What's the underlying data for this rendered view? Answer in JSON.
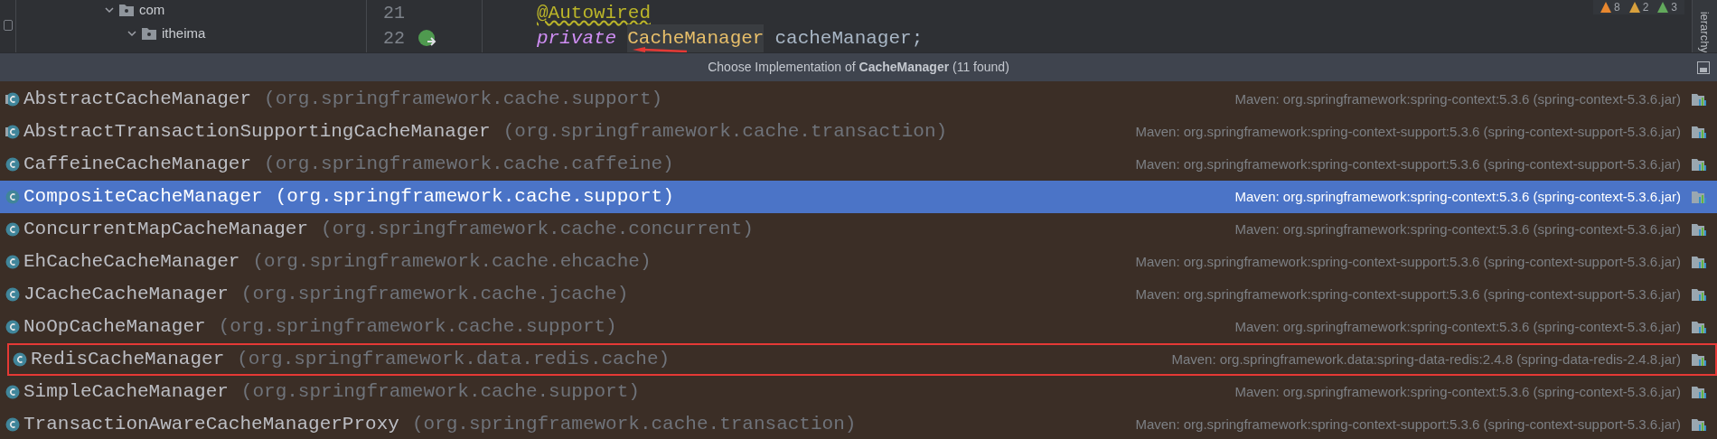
{
  "project_tree": {
    "items": [
      {
        "label": "com",
        "expanded": true
      },
      {
        "label": "itheima",
        "expanded": true
      }
    ]
  },
  "editor": {
    "lines": [
      {
        "number": "21",
        "tokens": [
          {
            "kind": "annotation",
            "text": "@Autowired"
          }
        ]
      },
      {
        "number": "22",
        "gutter_icon": true,
        "tokens": [
          {
            "kind": "keyword",
            "text": "private"
          },
          {
            "kind": "type",
            "text": "CacheManager"
          },
          {
            "kind": "plain",
            "text": "cacheManager;"
          }
        ]
      }
    ],
    "inspections": [
      {
        "kind": "error",
        "count": "8"
      },
      {
        "kind": "warning",
        "count": "2"
      },
      {
        "kind": "typo",
        "count": "3"
      }
    ],
    "side_tab": "ierarchy"
  },
  "popup": {
    "title": "Choose Implementation of **CacheManager** (11 found)",
    "rows": [
      {
        "kind": "abstract",
        "name": "AbstractCacheManager",
        "package": "(org.springframework.cache.support)",
        "location": "Maven: org.springframework:spring-context:5.3.6 (spring-context-5.3.6.jar)",
        "selected": false,
        "highlighted": false
      },
      {
        "kind": "abstract",
        "name": "AbstractTransactionSupportingCacheManager",
        "package": "(org.springframework.cache.transaction)",
        "location": "Maven: org.springframework:spring-context-support:5.3.6 (spring-context-support-5.3.6.jar)",
        "selected": false,
        "highlighted": false
      },
      {
        "kind": "class",
        "name": "CaffeineCacheManager",
        "package": "(org.springframework.cache.caffeine)",
        "location": "Maven: org.springframework:spring-context-support:5.3.6 (spring-context-support-5.3.6.jar)",
        "selected": false,
        "highlighted": false
      },
      {
        "kind": "class",
        "name": "CompositeCacheManager",
        "package": "(org.springframework.cache.support)",
        "location": "Maven: org.springframework:spring-context:5.3.6 (spring-context-5.3.6.jar)",
        "selected": true,
        "highlighted": false
      },
      {
        "kind": "class",
        "name": "ConcurrentMapCacheManager",
        "package": "(org.springframework.cache.concurrent)",
        "location": "Maven: org.springframework:spring-context:5.3.6 (spring-context-5.3.6.jar)",
        "selected": false,
        "highlighted": false
      },
      {
        "kind": "class",
        "name": "EhCacheCacheManager",
        "package": "(org.springframework.cache.ehcache)",
        "location": "Maven: org.springframework:spring-context-support:5.3.6 (spring-context-support-5.3.6.jar)",
        "selected": false,
        "highlighted": false
      },
      {
        "kind": "class",
        "name": "JCacheCacheManager",
        "package": "(org.springframework.cache.jcache)",
        "location": "Maven: org.springframework:spring-context-support:5.3.6 (spring-context-support-5.3.6.jar)",
        "selected": false,
        "highlighted": false
      },
      {
        "kind": "class",
        "name": "NoOpCacheManager",
        "package": "(org.springframework.cache.support)",
        "location": "Maven: org.springframework:spring-context:5.3.6 (spring-context-5.3.6.jar)",
        "selected": false,
        "highlighted": false
      },
      {
        "kind": "class",
        "name": "RedisCacheManager",
        "package": "(org.springframework.data.redis.cache)",
        "location": "Maven: org.springframework.data:spring-data-redis:2.4.8 (spring-data-redis-2.4.8.jar)",
        "selected": false,
        "highlighted": true
      },
      {
        "kind": "class",
        "name": "SimpleCacheManager",
        "package": "(org.springframework.cache.support)",
        "location": "Maven: org.springframework:spring-context:5.3.6 (spring-context-5.3.6.jar)",
        "selected": false,
        "highlighted": false
      },
      {
        "kind": "class",
        "name": "TransactionAwareCacheManagerProxy",
        "package": "(org.springframework.cache.transaction)",
        "location": "Maven: org.springframework:spring-context-support:5.3.6 (spring-context-support-5.3.6.jar)",
        "selected": false,
        "highlighted": false
      }
    ]
  }
}
